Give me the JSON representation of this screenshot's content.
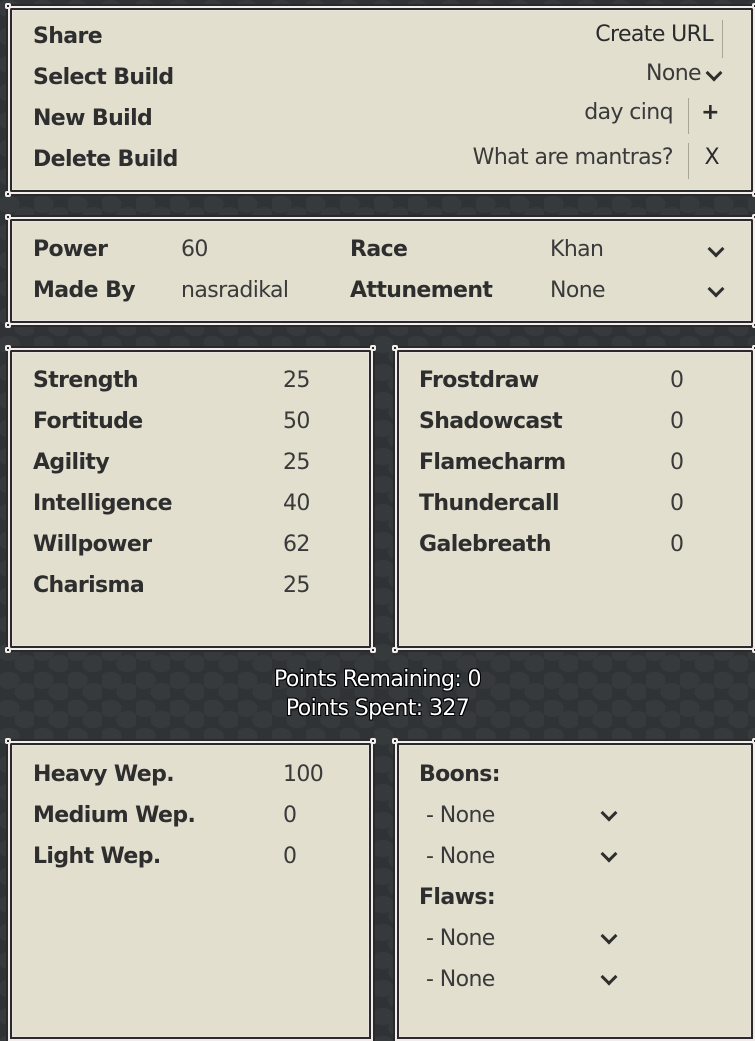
{
  "build_panel": {
    "share_label": "Share",
    "select_build_label": "Select Build",
    "new_build_label": "New Build",
    "delete_build_label": "Delete Build",
    "create_url_label": "Create URL",
    "selected_build": "None",
    "new_build_name": "day cinq",
    "add_label": "+",
    "mantras_link": "What are mantras?",
    "delete_label": "X"
  },
  "info_panel": {
    "power_label": "Power",
    "power_value": "60",
    "made_by_label": "Made By",
    "made_by_value": "nasradikal",
    "race_label": "Race",
    "race_value": "Khan",
    "attunement_label": "Attunement",
    "attunement_value": "None"
  },
  "attributes": [
    {
      "name": "Strength",
      "value": "25"
    },
    {
      "name": "Fortitude",
      "value": "50"
    },
    {
      "name": "Agility",
      "value": "25"
    },
    {
      "name": "Intelligence",
      "value": "40"
    },
    {
      "name": "Willpower",
      "value": "62"
    },
    {
      "name": "Charisma",
      "value": "25"
    }
  ],
  "attunements": [
    {
      "name": "Frostdraw",
      "value": "0"
    },
    {
      "name": "Shadowcast",
      "value": "0"
    },
    {
      "name": "Flamecharm",
      "value": "0"
    },
    {
      "name": "Thundercall",
      "value": "0"
    },
    {
      "name": "Galebreath",
      "value": "0"
    }
  ],
  "points": {
    "remaining_text": "Points Remaining: 0",
    "spent_text": "Points Spent: 327"
  },
  "weapons": [
    {
      "name": "Heavy Wep.",
      "value": "100"
    },
    {
      "name": "Medium Wep.",
      "value": "0"
    },
    {
      "name": "Light Wep.",
      "value": "0"
    }
  ],
  "traits": {
    "boons_label": "Boons:",
    "boons": [
      "- None",
      "- None"
    ],
    "flaws_label": "Flaws:",
    "flaws": [
      "- None",
      "- None"
    ]
  }
}
